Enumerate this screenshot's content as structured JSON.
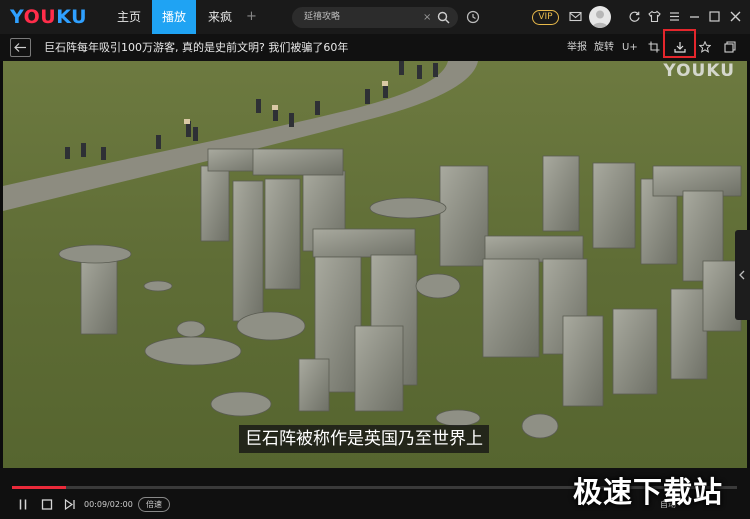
{
  "app": {
    "logo_parts": [
      "Y",
      "OU",
      "KU"
    ]
  },
  "nav": {
    "tabs": [
      {
        "label": "主页",
        "active": false
      },
      {
        "label": "播放",
        "active": true
      },
      {
        "label": "来疯",
        "active": false
      }
    ],
    "add_label": "+"
  },
  "search": {
    "value": "延禧攻略",
    "clear_glyph": "×"
  },
  "account": {
    "vip_label": "VIP"
  },
  "title_bar": {
    "title": "巨石阵每年吸引100万游客, 真的是史前文明? 我们被骗了60年",
    "actions": [
      "举报",
      "旋转",
      "U+"
    ]
  },
  "video": {
    "watermark": "YOUKU",
    "subtitle": "巨石阵被称作是英国乃至世界上"
  },
  "player": {
    "time_current": "00:09",
    "time_total": "02:00",
    "time_display": "00:09/02:00",
    "speed_label": "倍速",
    "quality_label": "自动",
    "progress_fraction": 0.075
  },
  "overlay": {
    "site_watermark": "极速下载站"
  },
  "colors": {
    "accent_tab": "#1fa3f3",
    "progress": "#ea2a3a",
    "highlight_box": "#e4262c",
    "vip": "#e8b94a"
  }
}
